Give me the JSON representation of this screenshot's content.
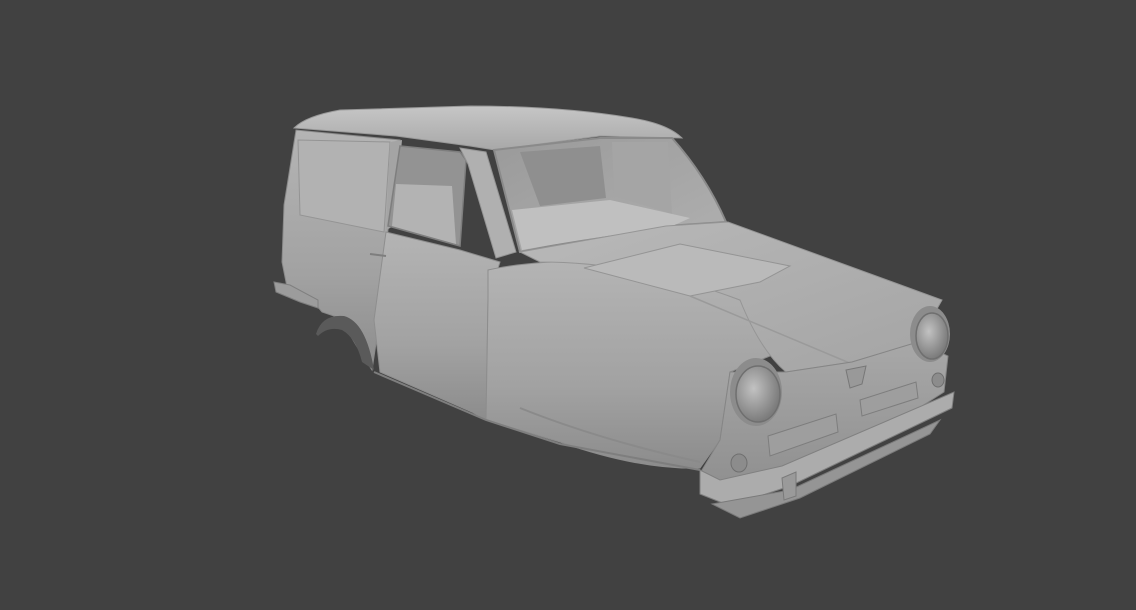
{
  "scene": {
    "background_color": "#414141",
    "model": {
      "subject": "car-body-shell",
      "material_color": "#a9a9a9",
      "highlight_color": "#c4c4c4",
      "shadow_color": "#7a7a7a",
      "dark_color": "#5e5e5e"
    }
  }
}
